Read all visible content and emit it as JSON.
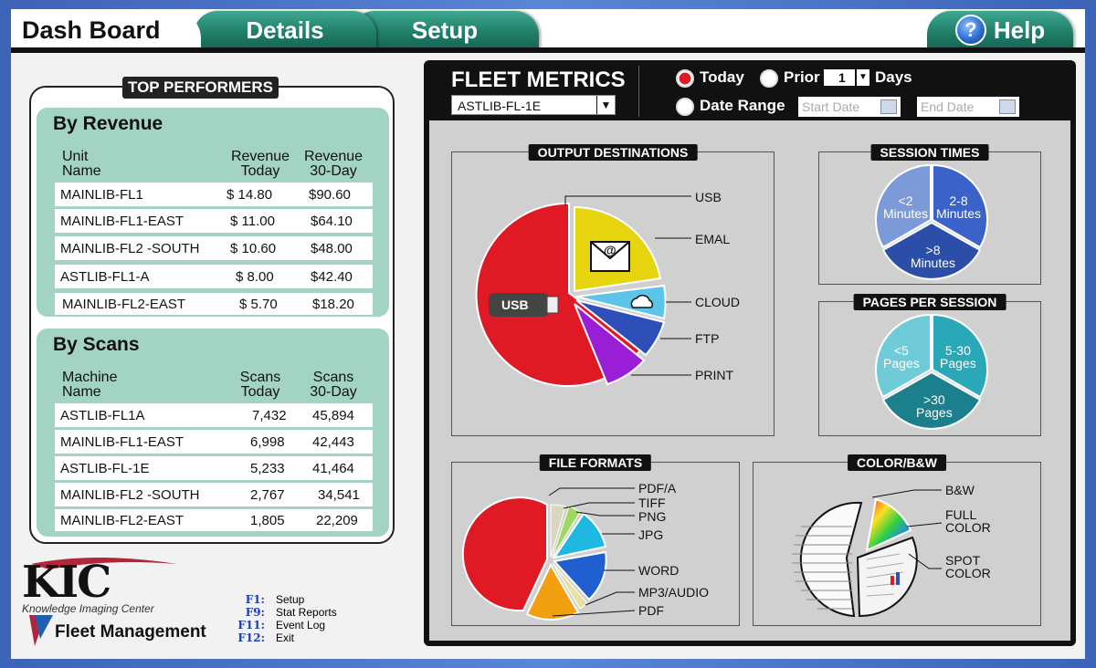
{
  "tabs": {
    "dashboard": "Dash Board",
    "details": "Details",
    "setup": "Setup",
    "help": "Help",
    "help_icon": "?"
  },
  "top_performers": {
    "title": "TOP PERFORMERS",
    "by_revenue": {
      "title": "By Revenue",
      "headers": {
        "unit_1": "Unit",
        "unit_2": "Name",
        "today_1": "Revenue",
        "today_2": "Today",
        "month_1": "Revenue",
        "month_2": "30-Day"
      },
      "rows": [
        {
          "name": "MAINLIB-FL1",
          "today": "$ 14.80",
          "month": "$90.60"
        },
        {
          "name": "MAINLIB-FL1-EAST",
          "today": "$ 11.00",
          "month": "$64.10"
        },
        {
          "name": "MAINLIB-FL2 -SOUTH",
          "today": "$ 10.60",
          "month": "$48.00"
        },
        {
          "name": "ASTLIB-FL1-A",
          "today": "$ 8.00",
          "month": "$42.40"
        },
        {
          "name": "MAINLIB-FL2-EAST",
          "today": "$ 5.70",
          "month": "$18.20"
        }
      ]
    },
    "by_scans": {
      "title": "By Scans",
      "headers": {
        "unit_1": "Machine",
        "unit_2": "Name",
        "today_1": "Scans",
        "today_2": "Today",
        "month_1": "Scans",
        "month_2": "30-Day"
      },
      "rows": [
        {
          "name": "ASTLIB-FL1A",
          "today": "7,432",
          "month": "45,894"
        },
        {
          "name": "MAINLIB-FL1-EAST",
          "today": "6,998",
          "month": "42,443"
        },
        {
          "name": "ASTLIB-FL-1E",
          "today": "5,233",
          "month": "41,464"
        },
        {
          "name": "MAINLIB-FL2 -SOUTH",
          "today": "2,767",
          "month": "34,541"
        },
        {
          "name": "MAINLIB-FL2-EAST",
          "today": "1,805",
          "month": "22,209"
        }
      ]
    }
  },
  "logo": {
    "kic": "KIC",
    "subtitle": "Knowledge Imaging Center",
    "product": "Fleet Management"
  },
  "fkeys": [
    {
      "key": "F1:",
      "label": "Setup"
    },
    {
      "key": "F9:",
      "label": "Stat Reports"
    },
    {
      "key": "F11:",
      "label": "Event Log"
    },
    {
      "key": "F12:",
      "label": "Exit"
    }
  ],
  "fleet": {
    "title": "FLEET METRICS",
    "selected_unit": "ASTLIB-FL-1E",
    "today": "Today",
    "prior": "Prior",
    "prior_days": "1",
    "days": "Days",
    "date_range": "Date Range",
    "start_placeholder": "Start Date",
    "end_placeholder": "End Date"
  },
  "output_destinations": {
    "title": "OUTPUT DESTINATIONS",
    "labels": [
      "USB",
      "EMAL",
      "CLOUD",
      "FTP",
      "PRINT"
    ],
    "usb_badge": "USB",
    "email_glyph": "@"
  },
  "session_times": {
    "title": "SESSION TIMES",
    "segments": [
      {
        "a": "<2",
        "b": "Minutes"
      },
      {
        "a": "2-8",
        "b": "Minutes"
      },
      {
        "a": ">8",
        "b": "Minutes"
      }
    ]
  },
  "pages_per_session": {
    "title": "PAGES PER SESSION",
    "segments": [
      {
        "a": "<5",
        "b": "Pages"
      },
      {
        "a": "5-30",
        "b": "Pages"
      },
      {
        "a": ">30",
        "b": "Pages"
      }
    ]
  },
  "file_formats": {
    "title": "FILE FORMATS",
    "labels": [
      "PDF/A",
      "TIFF",
      "PNG",
      "JPG",
      "WORD",
      "MP3/AUDIO",
      "PDF"
    ]
  },
  "color_bw": {
    "title": "COLOR/B&W",
    "labels": [
      "B&W",
      "FULL",
      "COLOR",
      "SPOT",
      "COLOR"
    ]
  },
  "colors": {
    "tab_green": "#1f7c66",
    "panel_green": "#a3d3c2",
    "pie_red": "#e01a25",
    "pie_yellow": "#e6d40e",
    "pie_lightblue": "#5cc4e8",
    "pie_blue": "#2e4fb8",
    "pie_purple": "#9a1ed6",
    "session_blue": "#3a62c8",
    "pages_teal": "#2aa8b8"
  }
}
